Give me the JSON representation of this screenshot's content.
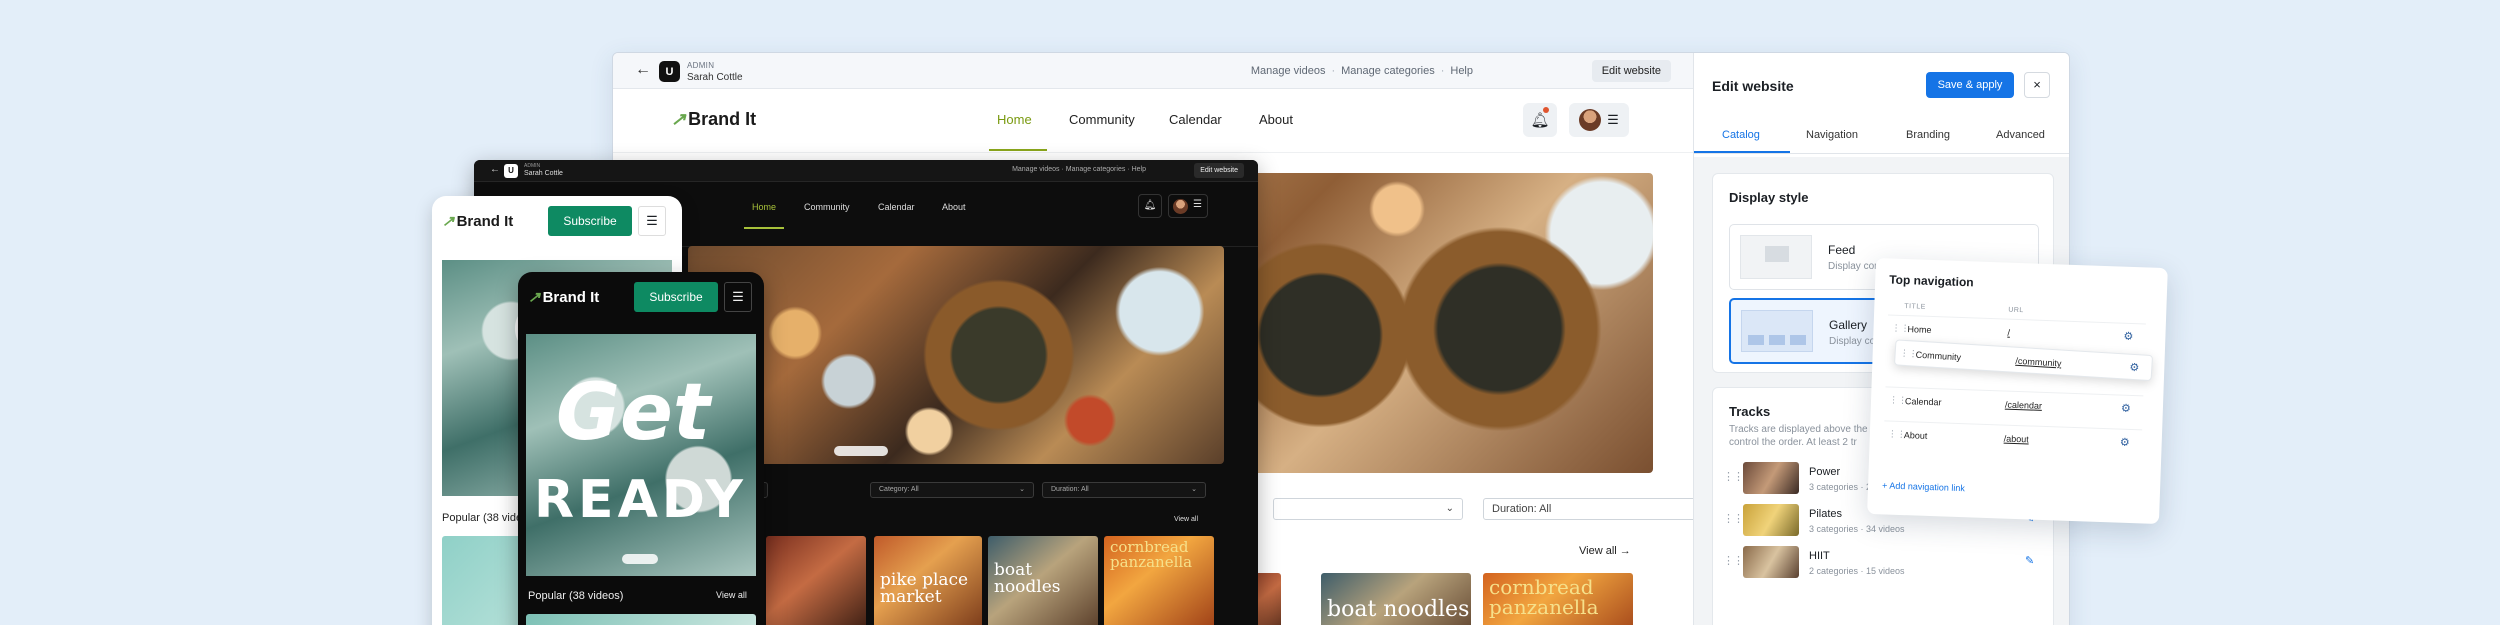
{
  "admin": {
    "back": "←",
    "logo": "U",
    "role": "ADMIN",
    "user": "Sarah Cottle",
    "links": [
      "Manage videos",
      "Manage categories",
      "Help"
    ],
    "sep": "·",
    "edit_website": "Edit website"
  },
  "site": {
    "brand": "Brand It",
    "brand_mark": "↗",
    "nav": [
      "Home",
      "Community",
      "Calendar",
      "About"
    ],
    "filters": [
      "Category: All",
      "Duration: All"
    ],
    "view_all": "View all →",
    "view_all_short": "View all",
    "thumb_texts": [
      "boat noodles",
      "cornbread panzanella"
    ],
    "thumb_texts_dark": [
      "pike place market",
      "boat noodles",
      "cornbread panzanella"
    ]
  },
  "panel": {
    "title": "Edit website",
    "save": "Save & apply",
    "close": "×",
    "tabs": [
      "Catalog",
      "Navigation",
      "Branding",
      "Advanced"
    ],
    "display_style": {
      "title": "Display style",
      "options": [
        {
          "name": "Feed",
          "desc": "Display com"
        },
        {
          "name": "Gallery",
          "desc": "Display com"
        }
      ]
    },
    "tracks": {
      "title": "Tracks",
      "desc": [
        "Tracks are displayed above the",
        "control the order. At least 2 tr"
      ],
      "items": [
        {
          "name": "Power",
          "meta": "3 categories · 26 videos"
        },
        {
          "name": "Pilates",
          "meta": "3 categories · 34 videos"
        },
        {
          "name": "HIIT",
          "meta": "2 categories · 15 videos"
        }
      ]
    }
  },
  "topnav": {
    "title": "Top navigation",
    "col_title": "TITLE",
    "col_url": "URL",
    "rows": [
      {
        "title": "Home",
        "url": "/"
      },
      {
        "title": "Community",
        "url": "/community"
      },
      {
        "title": "Calendar",
        "url": "/calendar"
      },
      {
        "title": "About",
        "url": "/about"
      }
    ],
    "add": "+ Add navigation link"
  },
  "phones": {
    "subscribe": "Subscribe",
    "menu": "☰",
    "hero_lines": [
      "Get",
      "READY"
    ],
    "popular": "Popular (38 videos)",
    "popular_cut": "Popular (38 vide",
    "view_all": "View all"
  },
  "colors": {
    "accent": "#1574e6",
    "brand_green": "#0e8a62",
    "nav_active": "#7a9a10"
  }
}
